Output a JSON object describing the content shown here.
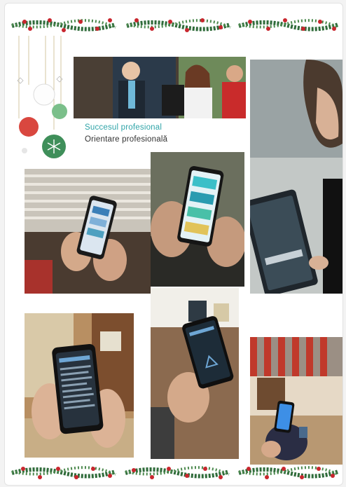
{
  "banner": {
    "title": "Succesul profesional",
    "subtitle": "Orientare profesională"
  },
  "colors": {
    "accent_teal": "#2fa4a8",
    "ornament_red": "#d9473f",
    "ornament_green": "#3f8f5a",
    "pine": "#2f6b3a",
    "berry": "#c8262e"
  },
  "icons": [
    "garland",
    "christmas-ornament",
    "snowflake"
  ]
}
